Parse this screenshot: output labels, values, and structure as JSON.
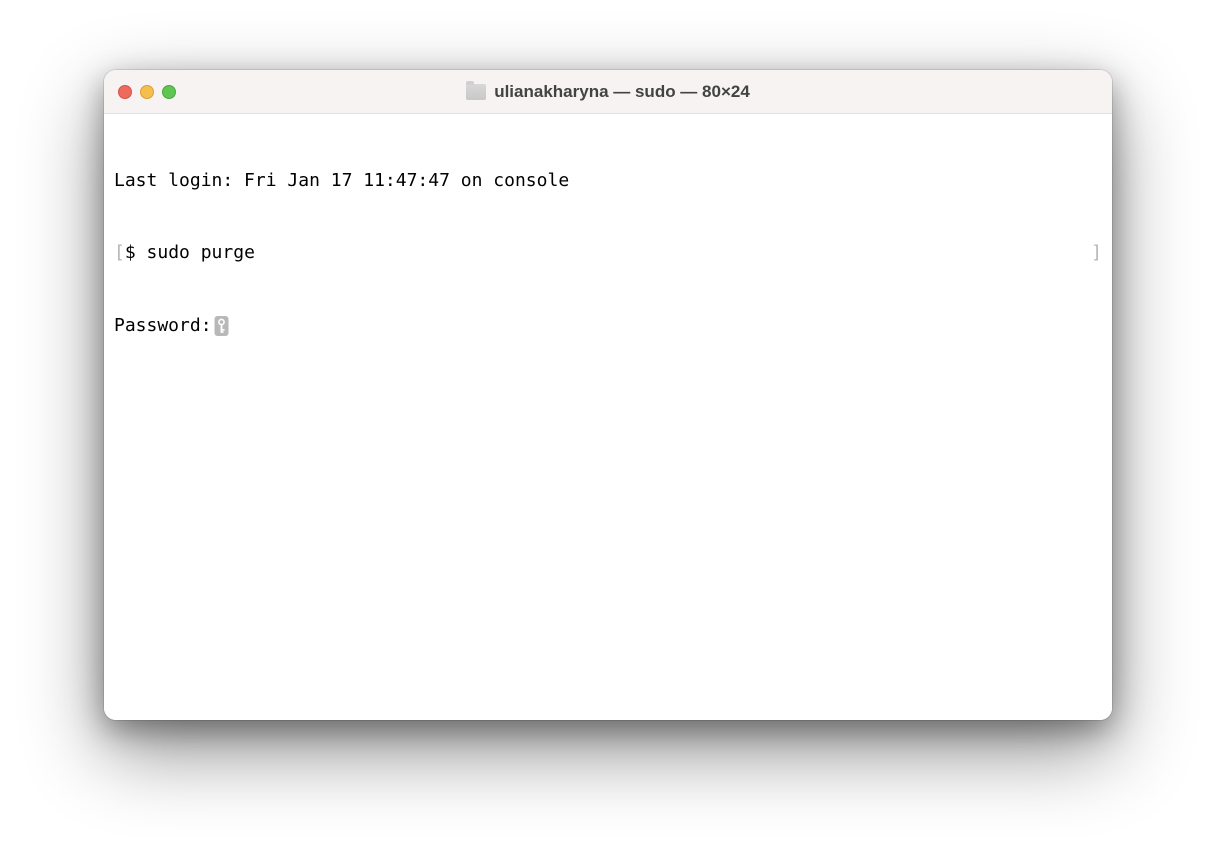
{
  "window": {
    "title": "ulianakharyna — sudo — 80×24"
  },
  "terminal": {
    "last_login": "Last login: Fri Jan 17 11:47:47 on console",
    "bracket_open": "[",
    "bracket_close": "]",
    "prompt_symbol": "$ ",
    "command": "sudo purge",
    "password_prompt": "Password:"
  }
}
